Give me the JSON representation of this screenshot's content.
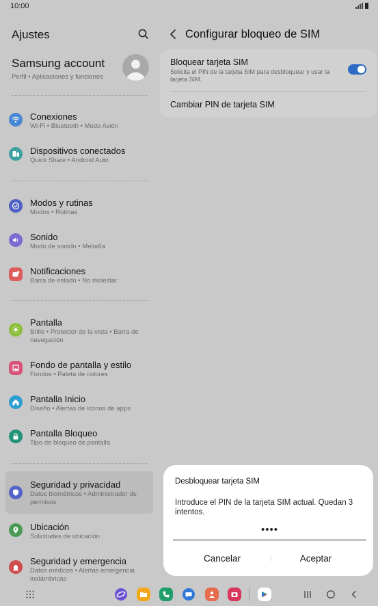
{
  "status_bar": {
    "time": "10:00"
  },
  "left": {
    "title": "Ajustes",
    "account": {
      "name": "Samsung account",
      "subtitle": "Perfil  •  Aplicaciones y funciones"
    },
    "items": [
      {
        "title": "Conexiones",
        "subtitle": "Wi-Fi  •  Bluetooth  •  Modo Avión",
        "icon": "wifi-icon",
        "color": "#4a86d6"
      },
      {
        "title": "Dispositivos conectados",
        "subtitle": "Quick Share  •  Android Auto",
        "icon": "devices-icon",
        "color": "#3fa0a4"
      },
      {
        "title": "Modos y rutinas",
        "subtitle": "Modos  •  Rutinas",
        "icon": "check-circle-icon",
        "color": "#4f62c4"
      },
      {
        "title": "Sonido",
        "subtitle": "Modo de sonido  •  Melodía",
        "icon": "volume-icon",
        "color": "#7a6cd2"
      },
      {
        "title": "Notificaciones",
        "subtitle": "Barra de estado  •  No molestar",
        "icon": "notification-icon",
        "color": "#dd5c5c"
      },
      {
        "title": "Pantalla",
        "subtitle": "Brillo  •  Protector de la vista  •  Barra de navegación",
        "icon": "sun-icon",
        "color": "#8bbf3a"
      },
      {
        "title": "Fondo de pantalla y estilo",
        "subtitle": "Fondos  •  Paleta de colores",
        "icon": "palette-icon",
        "color": "#d8557a"
      },
      {
        "title": "Pantalla Inicio",
        "subtitle": "Diseño  •  Alertas de iconos de apps",
        "icon": "home-icon",
        "color": "#2e9ed0"
      },
      {
        "title": "Pantalla Bloqueo",
        "subtitle": "Tipo de bloqueo de pantalla",
        "icon": "lock-icon",
        "color": "#23937a"
      },
      {
        "title": "Seguridad y privacidad",
        "subtitle": "Datos biométricos  •  Administrador de permisos",
        "icon": "shield-icon",
        "color": "#5364c8",
        "selected": true
      },
      {
        "title": "Ubicación",
        "subtitle": "Solicitudes de ubicación",
        "icon": "location-icon",
        "color": "#4a9a55"
      },
      {
        "title": "Seguridad y emergencia",
        "subtitle": "Datos médicos  •  Alertas emergencia inalámbricas",
        "icon": "emergency-icon",
        "color": "#cf4d4d"
      }
    ]
  },
  "right": {
    "title": "Configurar bloqueo de SIM",
    "lock_sim": {
      "title": "Bloquear tarjeta SIM",
      "subtitle": "Solicita el PIN de la tarjeta SIM para desbloquear y usar la tarjeta SIM.",
      "enabled": true
    },
    "change_pin": {
      "title": "Cambiar PIN de tarjeta SIM"
    }
  },
  "dialog": {
    "title": "Desbloquear tarjeta SIM",
    "message": "Introduce el PIN de la tarjeta SIM actual. Quedan 3 intentos.",
    "pin_value": "••••",
    "cancel_label": "Cancelar",
    "accept_label": "Aceptar"
  },
  "colors": {
    "accent": "#2d6bc4",
    "background": "#c9c9c9",
    "dialog": "#ffffff"
  }
}
